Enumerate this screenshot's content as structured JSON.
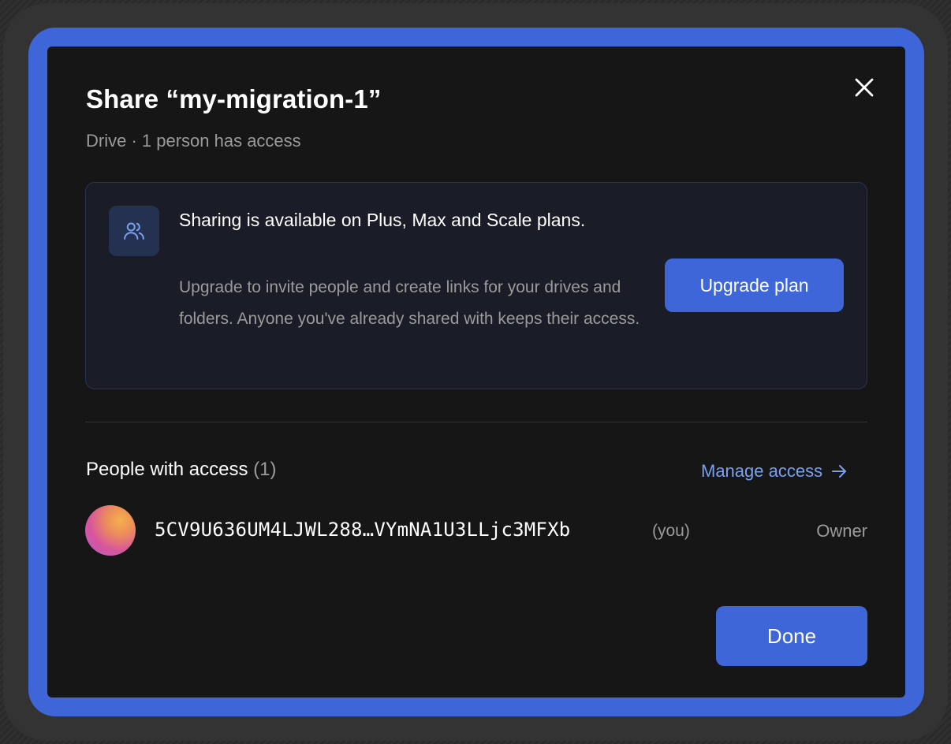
{
  "dialog": {
    "title": "Share “my-migration-1”",
    "subtitle": "Drive · 1 person has access",
    "close_icon": "close-icon"
  },
  "upgrade_card": {
    "icon": "users-icon",
    "heading": "Sharing is available on Plus, Max and Scale plans.",
    "body": "Upgrade to invite people and create links for your drives and folders. Anyone you've already shared with keeps their access.",
    "button_label": "Upgrade plan"
  },
  "people": {
    "heading": "People with access",
    "count": "(1)",
    "manage_label": "Manage access",
    "manage_icon": "arrow-right-icon",
    "items": [
      {
        "id": "5CV9U636UM4LJWL288…VYmNA1U3LLjc3MFXb",
        "you_label": "(you)",
        "role": "Owner"
      }
    ]
  },
  "footer": {
    "done_label": "Done"
  },
  "colors": {
    "accent": "#3e66d9",
    "link": "#7aa0f0",
    "dialog_bg": "#161616",
    "card_bg": "#1a1d28",
    "muted_text": "#9b9b9b"
  }
}
